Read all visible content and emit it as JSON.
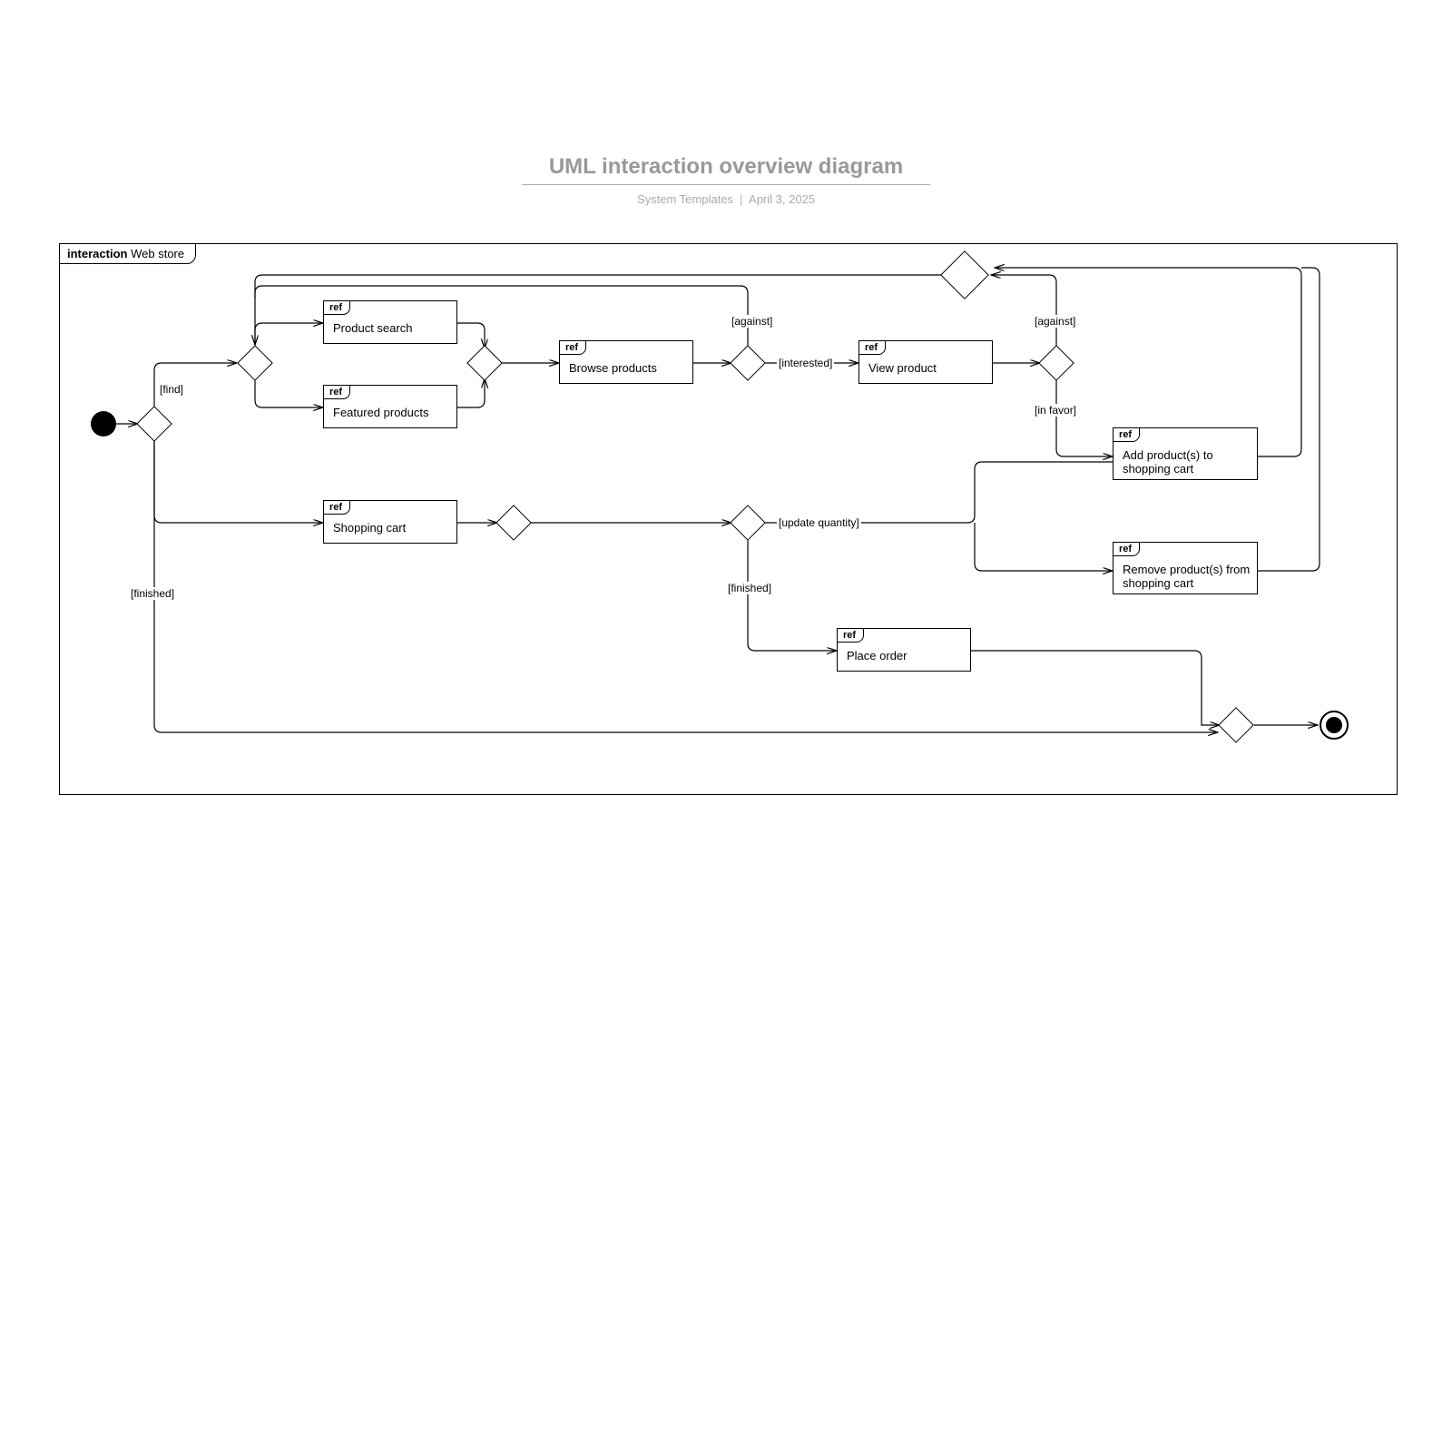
{
  "header": {
    "title": "UML interaction overview diagram",
    "subtitle_left": "System Templates",
    "subtitle_right": "April 3, 2025"
  },
  "frame": {
    "prefix": "interaction",
    "name": "Web store"
  },
  "refs": {
    "ref_tag": "ref",
    "product_search": "Product search",
    "featured_products": "Featured products",
    "browse_products": "Browse products",
    "view_product": "View product",
    "add_product": "Add product(s) to shopping cart",
    "remove_product": "Remove product(s) from shopping cart",
    "shopping_cart": "Shopping cart",
    "place_order": "Place order"
  },
  "edges": {
    "find": "[find]",
    "against": "[against]",
    "interested": "[interested]",
    "in_favor": "[in favor]",
    "update_quantity": "[update quantity]",
    "finished": "[finished]"
  }
}
